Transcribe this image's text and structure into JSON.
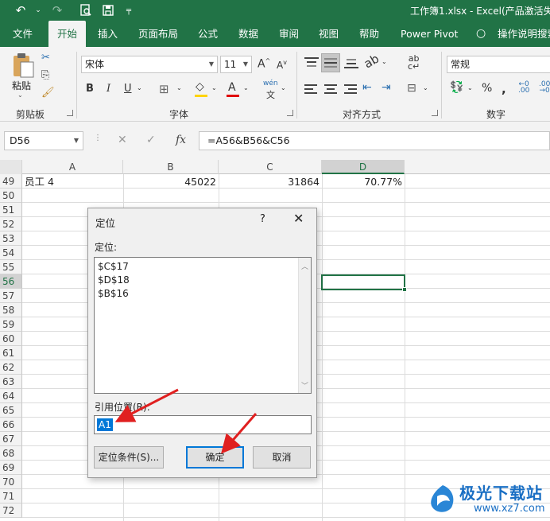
{
  "titlebar": {
    "title": "工作簿1.xlsx  -  Excel(产品激活失"
  },
  "tabs": [
    "文件",
    "开始",
    "插入",
    "页面布局",
    "公式",
    "数据",
    "审阅",
    "视图",
    "帮助",
    "Power Pivot",
    "操作说明搜索"
  ],
  "ribbon": {
    "clipboard": {
      "paste": "粘贴",
      "label": "剪贴板"
    },
    "font": {
      "name": "宋体",
      "size": "11",
      "grow": "A",
      "shrink": "A",
      "bold": "B",
      "italic": "I",
      "underline": "U",
      "color_a": "A",
      "pinyin": "wén",
      "label": "字体"
    },
    "alignment": {
      "label": "对齐方式"
    },
    "number": {
      "format": "常规",
      "label": "数字",
      "percent": "%"
    }
  },
  "formula_bar": {
    "name_box": "D56",
    "formula": "=A56&B56&C56",
    "fx": "fx"
  },
  "columns": [
    "A",
    "B",
    "C",
    "D"
  ],
  "rows": [
    "49",
    "50",
    "51",
    "52",
    "53",
    "54",
    "55",
    "56",
    "57",
    "58",
    "59",
    "60",
    "61",
    "62",
    "63",
    "64",
    "65",
    "66",
    "67",
    "68",
    "69",
    "70",
    "71",
    "72"
  ],
  "row49": {
    "a": "员工 4",
    "b": "45022",
    "c": "31864",
    "d": "70.77%"
  },
  "dialog": {
    "title": "定位",
    "help": "?",
    "goto_label": "定位:",
    "items": [
      "$C$17",
      "$D$18",
      "$B$16"
    ],
    "ref_label": "引用位置(R):",
    "ref_value": "A1",
    "special_button": "定位条件(S)...",
    "ok_button": "确定",
    "cancel_button": "取消"
  },
  "watermark": {
    "brand": "极光下载站",
    "url": "www.xz7.com"
  },
  "colors": {
    "accent": "#217346",
    "arrow": "#e02020",
    "selection": "#0078d7"
  }
}
